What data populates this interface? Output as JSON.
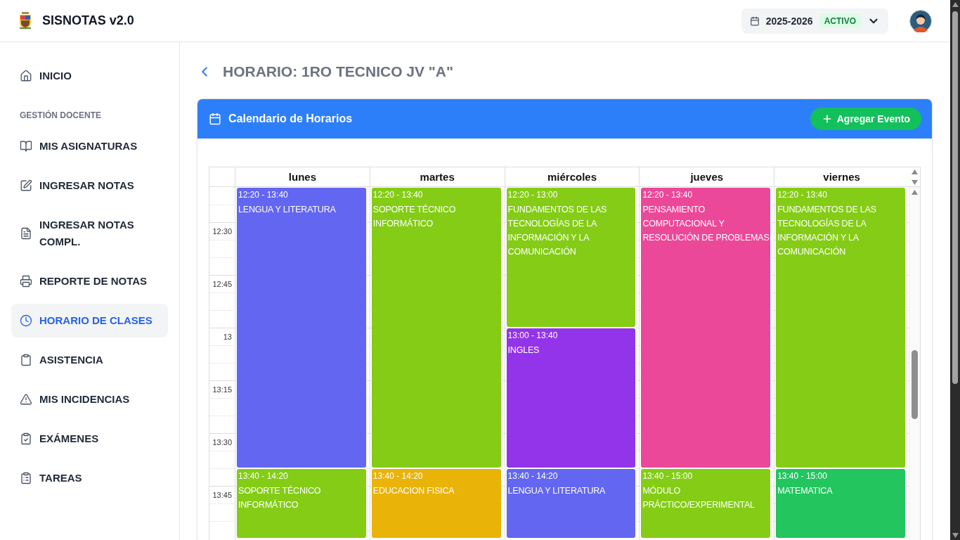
{
  "header": {
    "app_name": "SISNOTAS v2.0",
    "period": {
      "year": "2025-2026",
      "status": "ACTIVO"
    }
  },
  "sidebar": {
    "items": [
      {
        "label": "INICIO",
        "selected": false
      }
    ],
    "section": {
      "title": "GESTIÓN DOCENTE",
      "items": [
        {
          "label": "MIS ASIGNATURAS",
          "selected": false
        },
        {
          "label": "INGRESAR NOTAS",
          "selected": false
        },
        {
          "label": "INGRESAR NOTAS COMPL.",
          "selected": false
        },
        {
          "label": "REPORTE DE NOTAS",
          "selected": false
        },
        {
          "label": "HORARIO DE CLASES",
          "selected": true
        },
        {
          "label": "ASISTENCIA",
          "selected": false
        },
        {
          "label": "MIS INCIDENCIAS",
          "selected": false
        },
        {
          "label": "EXÁMENES",
          "selected": false
        },
        {
          "label": "TAREAS",
          "selected": false
        }
      ]
    }
  },
  "page": {
    "title": "HORARIO: 1RO TECNICO JV \"A\""
  },
  "calendar": {
    "title": "Calendario de Horarios",
    "add_button": "Agregar Evento",
    "time_labels": [
      "12:30",
      "12:45",
      "13",
      "13:15",
      "13:30",
      "13:45"
    ],
    "days": [
      {
        "name": "lunes",
        "events": [
          {
            "time": "12:20 - 13:40",
            "title": "LENGUA Y LITERATURA",
            "color": "#6366f1"
          },
          {
            "time": "13:40 - 14:20",
            "title": "SOPORTE TÉCNICO INFORMÁTICO",
            "color": "#84cc16"
          }
        ]
      },
      {
        "name": "martes",
        "events": [
          {
            "time": "12:20 - 13:40",
            "title": "SOPORTE TÉCNICO INFORMÁTICO",
            "color": "#84cc16"
          },
          {
            "time": "13:40 - 14:20",
            "title": "EDUCACION FISICA",
            "color": "#eab308"
          }
        ]
      },
      {
        "name": "miércoles",
        "events": [
          {
            "time": "12:20 - 13:00",
            "title": "FUNDAMENTOS DE LAS TECNOLOGÍAS DE LA INFORMACIÓN Y LA COMUNICACIÓN",
            "color": "#84cc16"
          },
          {
            "time": "13:00 - 13:40",
            "title": "INGLES",
            "color": "#9333ea"
          },
          {
            "time": "13:40 - 14:20",
            "title": "LENGUA Y LITERATURA",
            "color": "#6366f1"
          }
        ]
      },
      {
        "name": "jueves",
        "events": [
          {
            "time": "12:20 - 13:40",
            "title": "PENSAMIENTO COMPUTACIONAL Y RESOLUCIÓN DE PROBLEMAS",
            "color": "#ec4899"
          },
          {
            "time": "13:40 - 15:00",
            "title": "MÓDULO PRÁCTICO/EXPERIMENTAL",
            "color": "#84cc16"
          }
        ]
      },
      {
        "name": "viernes",
        "events": [
          {
            "time": "12:20 - 13:40",
            "title": "FUNDAMENTOS DE LAS TECNOLOGÍAS DE LA INFORMACIÓN Y LA COMUNICACIÓN",
            "color": "#84cc16"
          },
          {
            "time": "13:40 - 15:00",
            "title": "MATEMATICA",
            "color": "#22c55e"
          }
        ]
      }
    ]
  }
}
